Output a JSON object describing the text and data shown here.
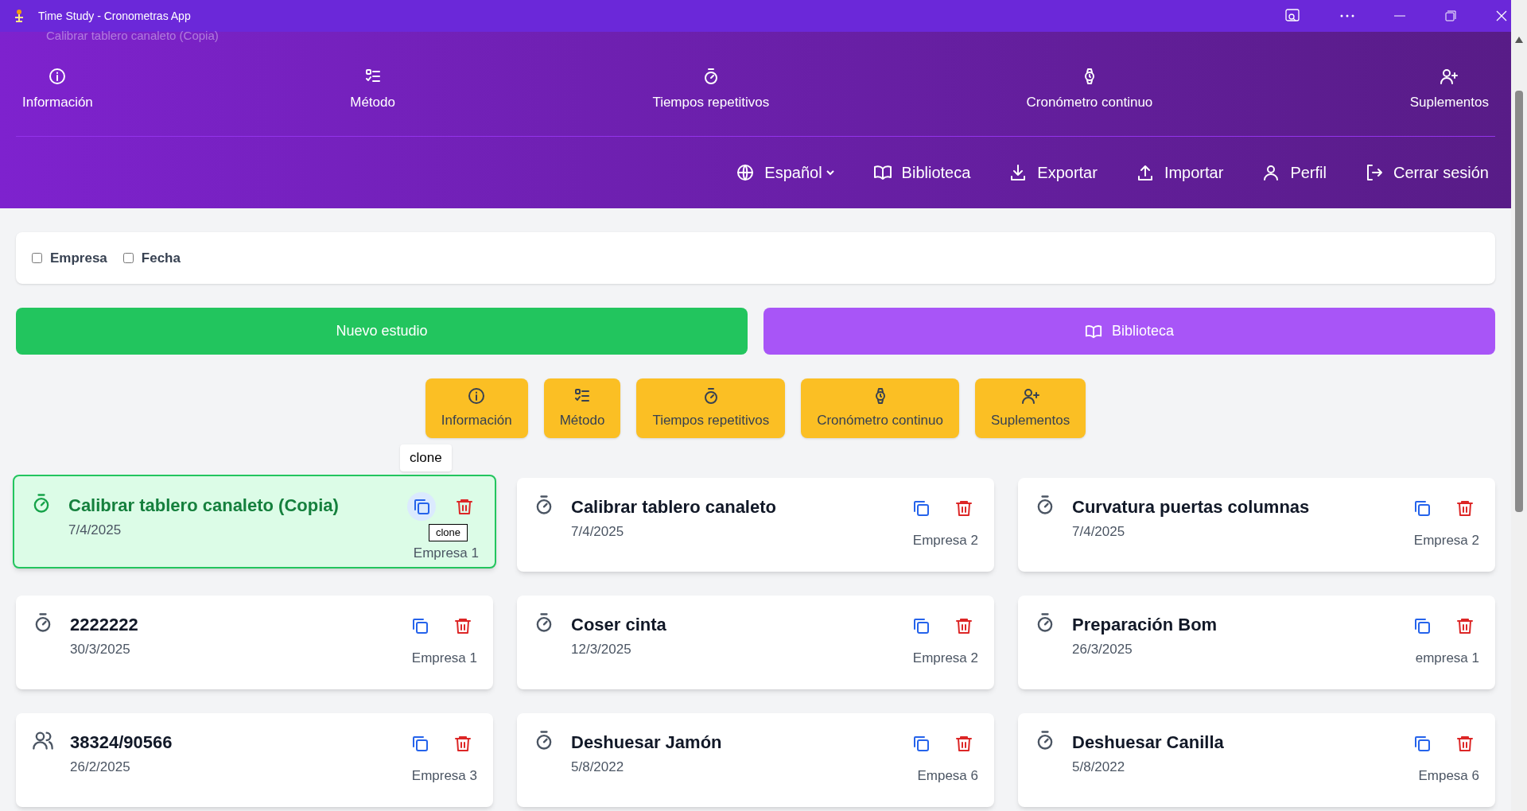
{
  "window": {
    "title": "Time Study - Cronometras App"
  },
  "header": {
    "behind_text": "Calibrar tablero canaleto (Copia)",
    "nav": [
      {
        "kind": "info",
        "label": "Información"
      },
      {
        "kind": "list",
        "label": "Método"
      },
      {
        "kind": "timer",
        "label": "Tiempos repetitivos"
      },
      {
        "kind": "watch",
        "label": "Cronómetro continuo"
      },
      {
        "kind": "userplus",
        "label": "Suplementos"
      }
    ],
    "actions": [
      {
        "kind": "globe",
        "label": "Español",
        "dropdown": true
      },
      {
        "kind": "book",
        "label": "Biblioteca",
        "dropdown": false
      },
      {
        "kind": "download",
        "label": "Exportar",
        "dropdown": false
      },
      {
        "kind": "upload",
        "label": "Importar",
        "dropdown": false
      },
      {
        "kind": "user",
        "label": "Perfil",
        "dropdown": false
      },
      {
        "kind": "logout",
        "label": "Cerrar sesión",
        "dropdown": false
      }
    ]
  },
  "filters": [
    {
      "label": "Empresa",
      "checked": false
    },
    {
      "label": "Fecha",
      "checked": false
    }
  ],
  "buttons": {
    "new": "Nuevo estudio",
    "library": "Biblioteca"
  },
  "quick_tabs": [
    {
      "kind": "info",
      "label": "Información"
    },
    {
      "kind": "list",
      "label": "Método"
    },
    {
      "kind": "timer",
      "label": "Tiempos repetitivos"
    },
    {
      "kind": "watch",
      "label": "Cronómetro continuo"
    },
    {
      "kind": "userplus",
      "label": "Suplementos"
    }
  ],
  "studies": [
    {
      "kind": "timer",
      "title": "Calibrar tablero canaleto (Copia)",
      "date": "7/4/2025",
      "company": "Empresa 1",
      "selected": true,
      "tooltip": "clone",
      "tooltip_small": "clone"
    },
    {
      "kind": "timer",
      "title": "Calibrar tablero canaleto",
      "date": "7/4/2025",
      "company": "Empresa 2",
      "selected": false
    },
    {
      "kind": "timer",
      "title": "Curvatura puertas columnas",
      "date": "7/4/2025",
      "company": "Empresa 2",
      "selected": false
    },
    {
      "kind": "timer",
      "title": "2222222",
      "date": "30/3/2025",
      "company": "Empresa 1",
      "selected": false
    },
    {
      "kind": "timer",
      "title": "Coser cinta",
      "date": "12/3/2025",
      "company": "Empresa 2",
      "selected": false
    },
    {
      "kind": "timer",
      "title": "Preparación Bom",
      "date": "26/3/2025",
      "company": "empresa 1",
      "selected": false
    },
    {
      "kind": "users",
      "title": "38324/90566",
      "date": "26/2/2025",
      "company": "Empresa 3",
      "selected": false
    },
    {
      "kind": "timer",
      "title": "Deshuesar Jamón",
      "date": "5/8/2022",
      "company": "Empesa 6",
      "selected": false
    },
    {
      "kind": "timer",
      "title": "Deshuesar Canilla",
      "date": "5/8/2022",
      "company": "Empesa 6",
      "selected": false
    }
  ]
}
